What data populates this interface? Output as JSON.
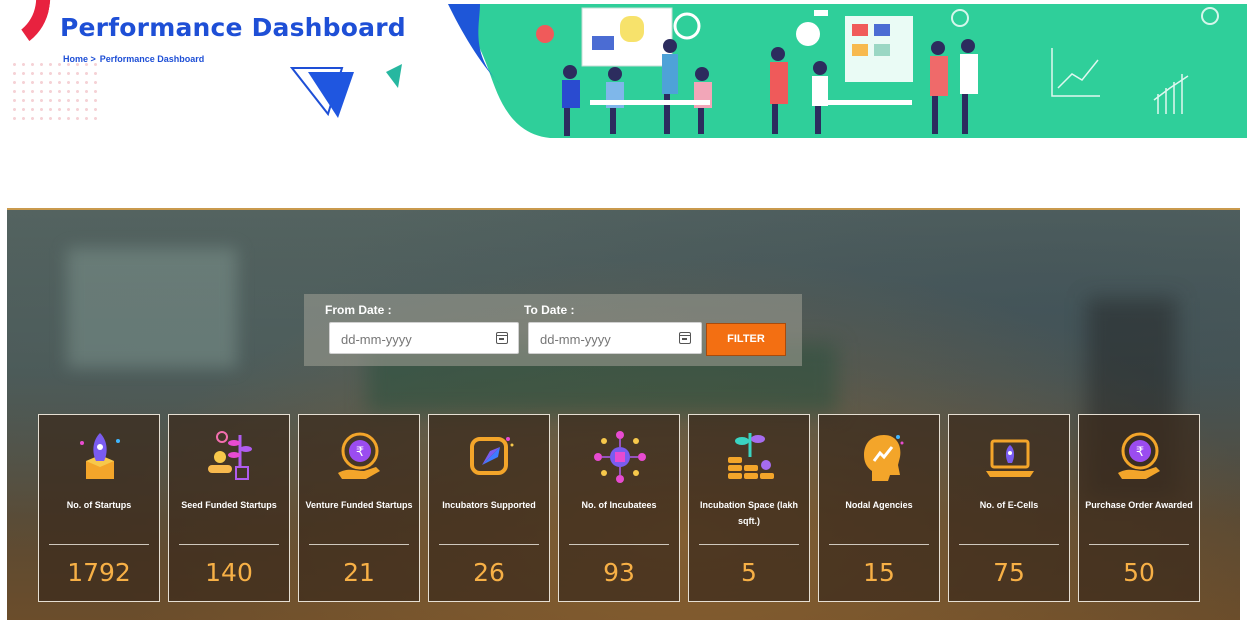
{
  "header": {
    "title": "Performance Dashboard",
    "breadcrumb": {
      "home": "Home >",
      "current": "Performance Dashboard"
    }
  },
  "filter": {
    "from_label": "From Date :",
    "from_placeholder": "dd-mm-yyyy",
    "to_label": "To Date :",
    "to_placeholder": "dd-mm-yyyy",
    "button_label": "FILTER",
    "button_color": "#f36f12"
  },
  "stats": [
    {
      "icon": "rocket-box-icon",
      "label": "No. of Startups",
      "value": "1792"
    },
    {
      "icon": "plant-coins-hand-icon",
      "label": "Seed Funded Startups",
      "value": "140"
    },
    {
      "icon": "rupee-hand-icon",
      "label": "Venture Funded Startups",
      "value": "21"
    },
    {
      "icon": "rocket-tile-icon",
      "label": "Incubators Supported",
      "value": "26"
    },
    {
      "icon": "network-cube-icon",
      "label": "No. of Incubatees",
      "value": "93"
    },
    {
      "icon": "plant-coin-stacks-icon",
      "label": "Incubation Space (lakh sqft.)",
      "value": "5"
    },
    {
      "icon": "head-chart-icon",
      "label": "Nodal Agencies",
      "value": "15"
    },
    {
      "icon": "laptop-rocket-icon",
      "label": "No. of E-Cells",
      "value": "75"
    },
    {
      "icon": "rupee-hand-icon",
      "label": "Purchase Order Awarded",
      "value": "50"
    }
  ],
  "colors": {
    "title_blue": "#1e4fd6",
    "value_orange": "#f7b046",
    "banner_teal": "#2fcf9a"
  }
}
